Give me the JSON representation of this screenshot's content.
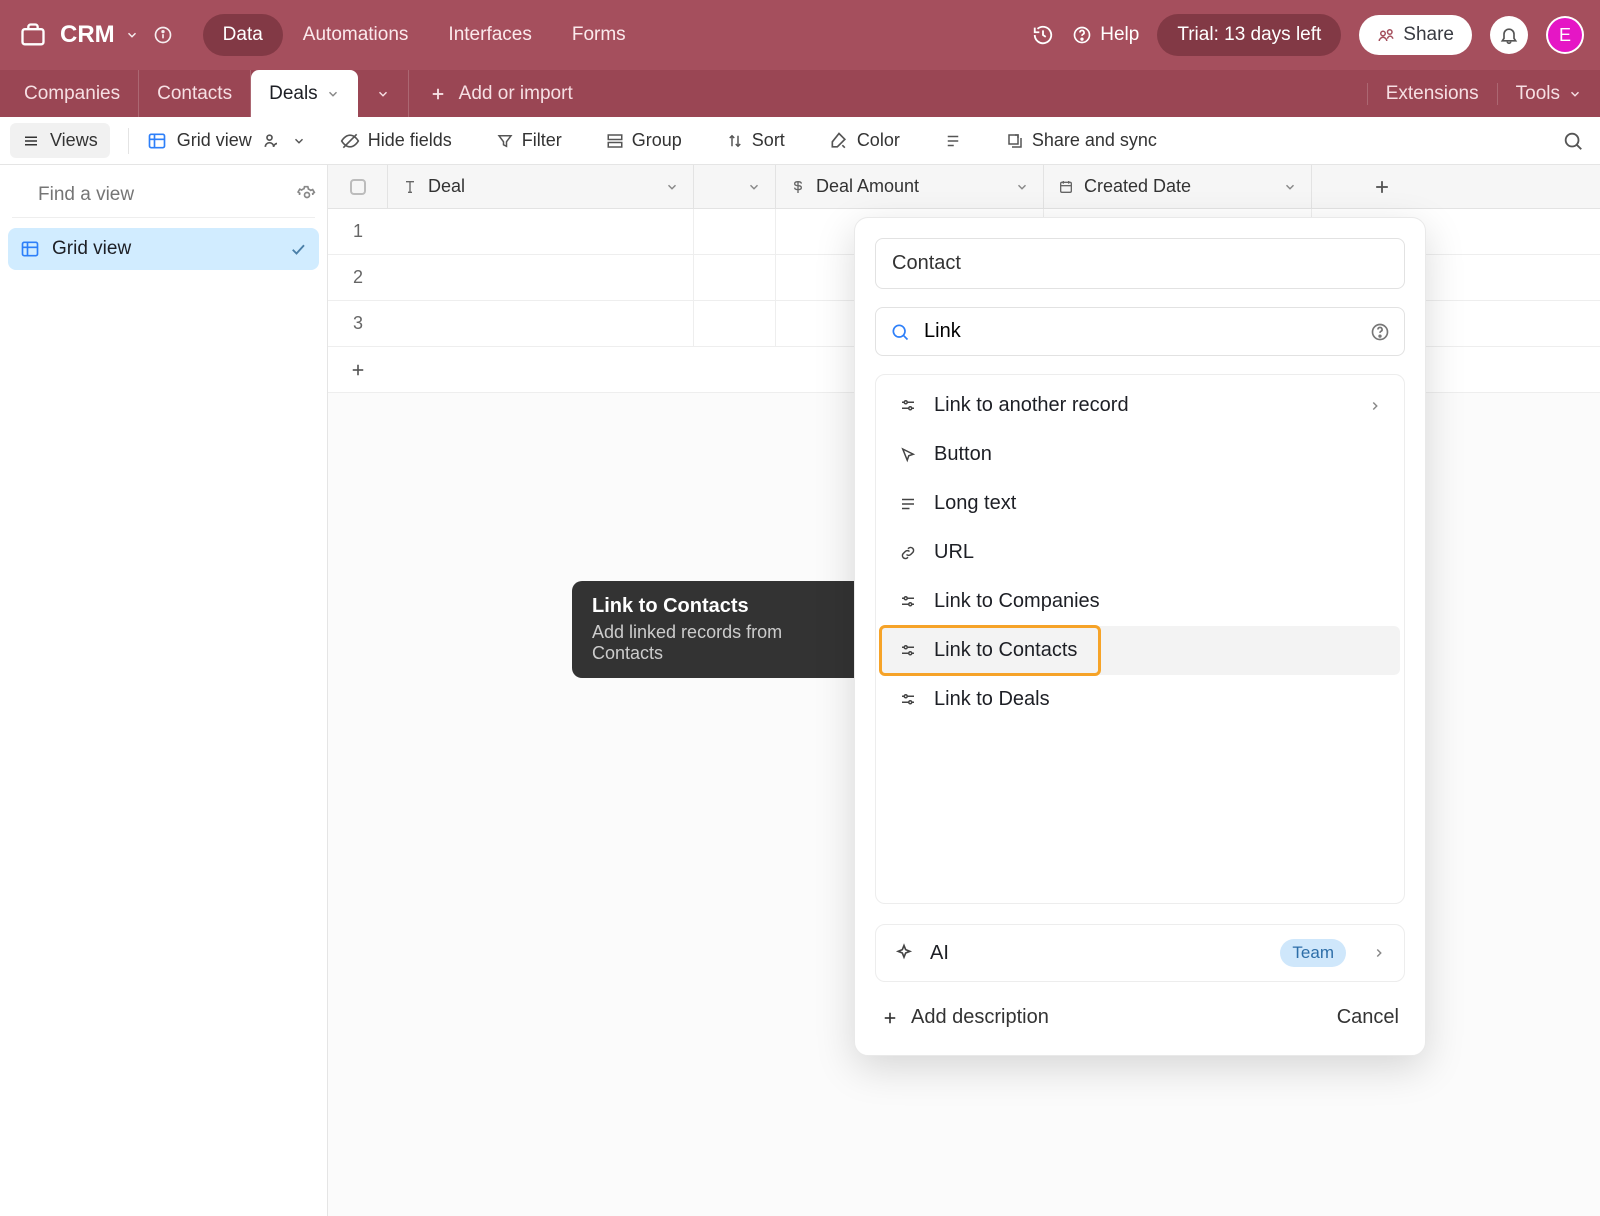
{
  "top": {
    "workspace": "CRM",
    "tabs": [
      "Data",
      "Automations",
      "Interfaces",
      "Forms"
    ],
    "active_tab_index": 0,
    "help": "Help",
    "trial": "Trial: 13 days left",
    "share": "Share",
    "avatar_initial": "E"
  },
  "table_tabs": {
    "items": [
      "Companies",
      "Contacts",
      "Deals"
    ],
    "active_index": 2,
    "add_or_import": "Add or import",
    "extensions": "Extensions",
    "tools": "Tools"
  },
  "view_toolbar": {
    "views_label": "Views",
    "grid_view": "Grid view",
    "hide_fields": "Hide fields",
    "filter": "Filter",
    "group": "Group",
    "sort": "Sort",
    "color": "Color",
    "share_sync": "Share and sync"
  },
  "sidebar": {
    "find_placeholder": "Find a view",
    "views": [
      {
        "name": "Grid view",
        "active": true
      }
    ]
  },
  "grid": {
    "columns": [
      {
        "name": "Deal",
        "icon": "text"
      },
      {
        "name": "",
        "icon": ""
      },
      {
        "name": "Deal Amount",
        "icon": "currency"
      },
      {
        "name": "Created Date",
        "icon": "date"
      }
    ],
    "rows": [
      "1",
      "2",
      "3"
    ]
  },
  "tooltip": {
    "title": "Link to Contacts",
    "subtitle": "Add linked records from Contacts"
  },
  "popup": {
    "field_name_value": "Contact",
    "search_value": "Link",
    "types": [
      {
        "label": "Link to another record",
        "icon": "sliders",
        "has_chevron": true
      },
      {
        "label": "Button",
        "icon": "cursor"
      },
      {
        "label": "Long text",
        "icon": "longtext"
      },
      {
        "label": "URL",
        "icon": "link"
      },
      {
        "label": "Link to Companies",
        "icon": "sliders"
      },
      {
        "label": "Link to Contacts",
        "icon": "sliders",
        "highlight": true
      },
      {
        "label": "Link to Deals",
        "icon": "sliders"
      }
    ],
    "ai_label": "AI",
    "team_badge": "Team",
    "add_description": "Add description",
    "cancel": "Cancel"
  }
}
